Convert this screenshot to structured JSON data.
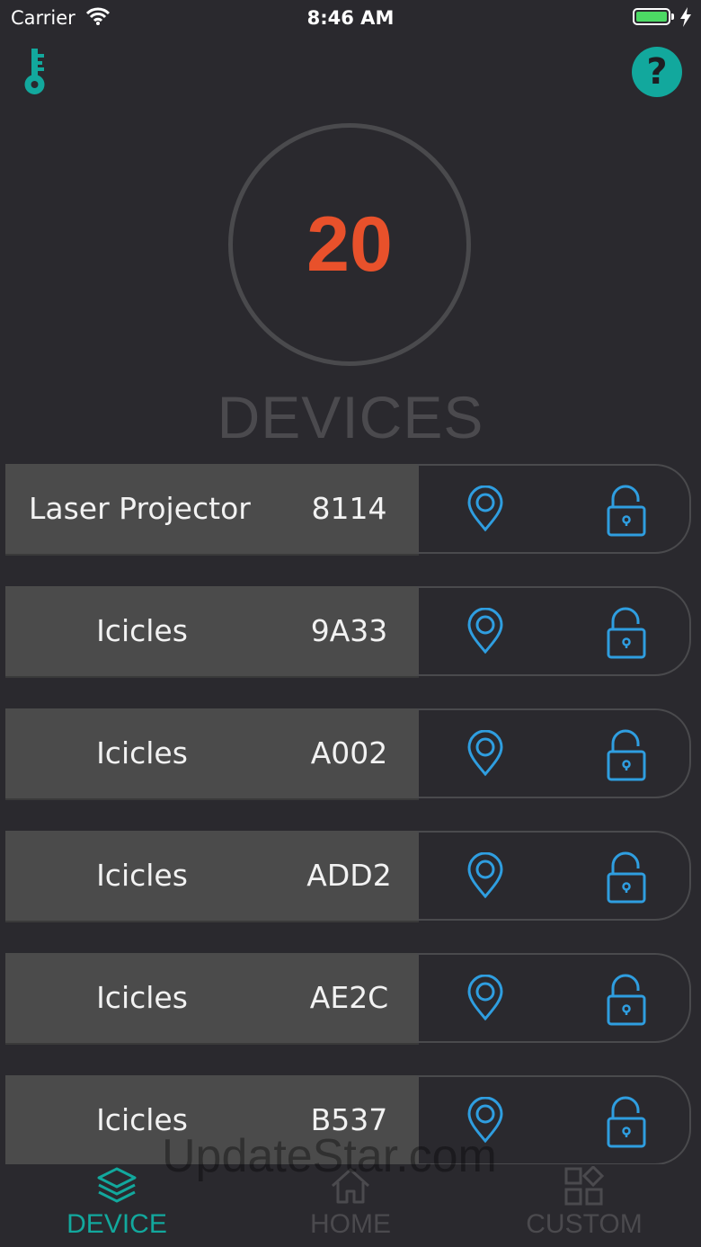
{
  "status_bar": {
    "carrier": "Carrier",
    "time": "8:46 AM"
  },
  "header": {
    "key_icon": "key-icon",
    "help_icon": "help-icon",
    "help_glyph": "?"
  },
  "summary": {
    "count": "20",
    "title": "DEVICES",
    "count_color": "#e8512b"
  },
  "devices": [
    {
      "name": "Laser Projector",
      "id": "8114"
    },
    {
      "name": "Icicles",
      "id": "9A33"
    },
    {
      "name": "Icicles",
      "id": "A002"
    },
    {
      "name": "Icicles",
      "id": "ADD2"
    },
    {
      "name": "Icicles",
      "id": "AE2C"
    },
    {
      "name": "Icicles",
      "id": "B537"
    }
  ],
  "watermark": "UpdateStar.com",
  "tabs": [
    {
      "label": "DEVICE",
      "active": true
    },
    {
      "label": "HOME",
      "active": false
    },
    {
      "label": "CUSTOM",
      "active": false
    }
  ],
  "colors": {
    "accent": "#12a89d",
    "icon_blue": "#2f9ee0",
    "background": "#2a292e",
    "row_fill": "#4b4b4b"
  }
}
